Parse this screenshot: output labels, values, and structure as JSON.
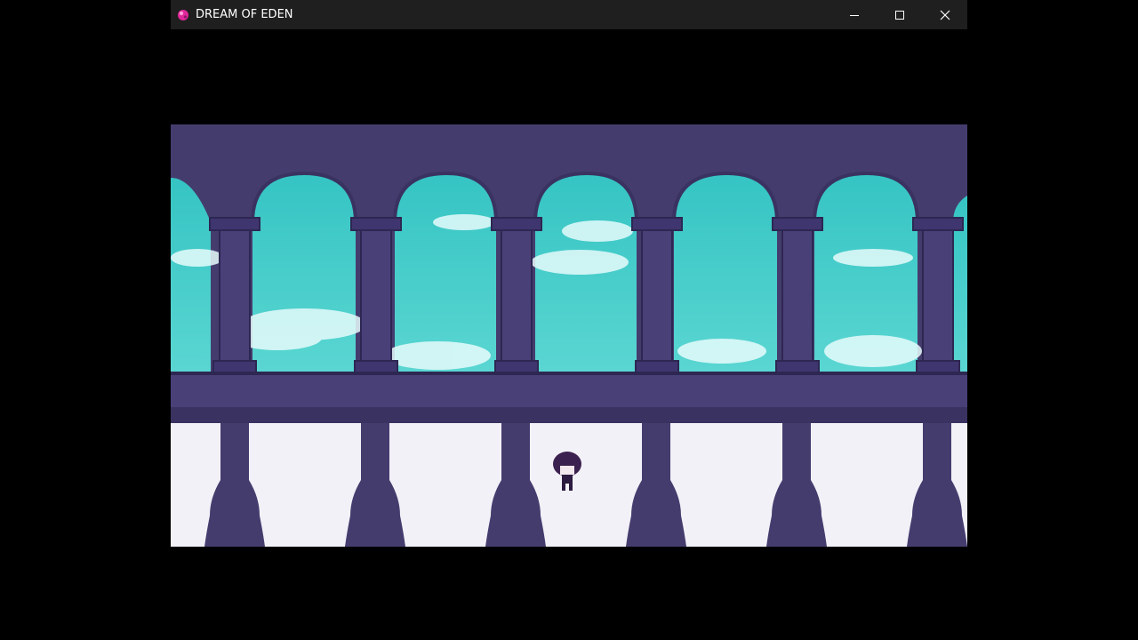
{
  "window": {
    "title": "DREAM OF EDEN",
    "app_icon": "pink-gem-icon",
    "controls": [
      {
        "name": "minimize-button",
        "icon": "minimize-icon"
      },
      {
        "name": "maximize-button",
        "icon": "maximize-icon"
      },
      {
        "name": "close-button",
        "icon": "close-icon"
      }
    ]
  },
  "scene": {
    "description_colors": {
      "stone": "#453c6e",
      "stone_dark": "#3a3260",
      "sky": "#3ccfcb",
      "cloud": "#e8fbfb",
      "floor": "#f3f1f8"
    }
  }
}
